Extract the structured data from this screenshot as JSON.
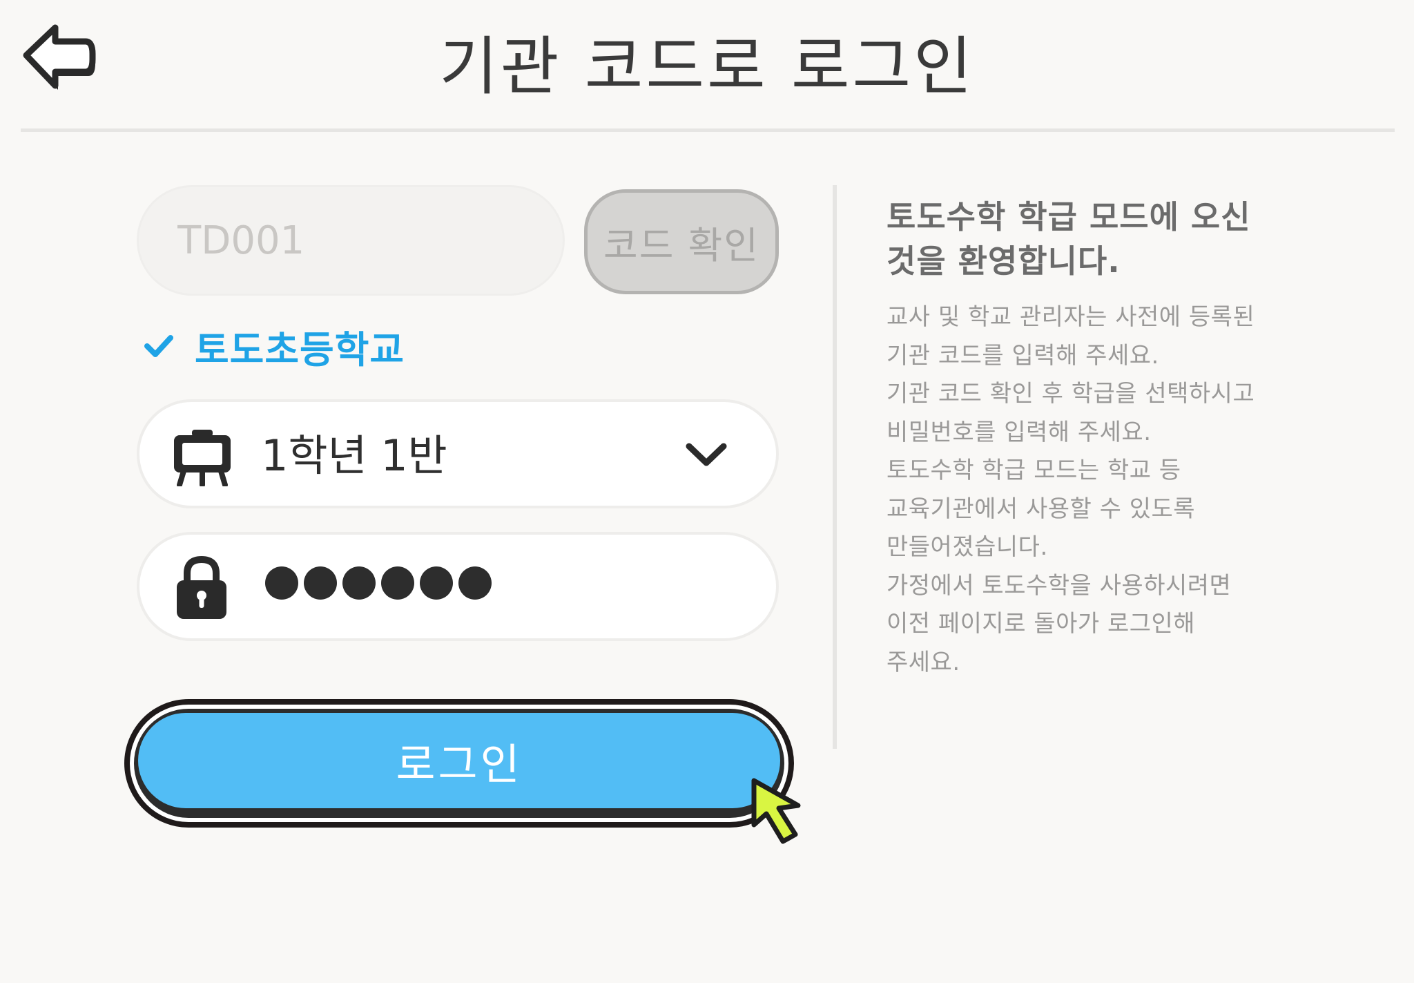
{
  "header": {
    "back_icon": "back-arrow-icon",
    "title": "기관 코드로 로그인"
  },
  "form": {
    "code_input": {
      "value": "",
      "placeholder": "TD001"
    },
    "confirm_button_label": "코드 확인",
    "verified_school": {
      "icon": "check-icon",
      "name": "토도초등학교"
    },
    "class_select": {
      "icon": "class-board-icon",
      "selected_value": "1학년 1반",
      "dropdown_icon": "chevron-down-icon"
    },
    "password": {
      "icon": "lock-icon",
      "masked_display": "●●●●●●"
    },
    "login_button_label": "로그인"
  },
  "info_panel": {
    "title_lines": [
      "토도수학 학급 모드에 오신",
      "것을 환영합니다."
    ],
    "body_lines": [
      "교사 및 학교 관리자는 사전에 등록된",
      "기관 코드를 입력해 주세요.",
      "기관 코드 확인 후 학급을 선택하시고",
      "비밀번호를 입력해 주세요.",
      "토도수학 학급 모드는 학교 등",
      "교육기관에서 사용할 수 있도록",
      "만들어졌습니다.",
      "가정에서 토도수학을 사용하시려면",
      "이전 페이지로 돌아가 로그인해",
      "주세요."
    ]
  },
  "colors": {
    "background": "#f9f8f6",
    "accent_blue": "#1fa3e6",
    "login_button": "#52bdf5",
    "cursor_yellow": "#d9f542",
    "disabled_gray": "#d5d4d2"
  }
}
